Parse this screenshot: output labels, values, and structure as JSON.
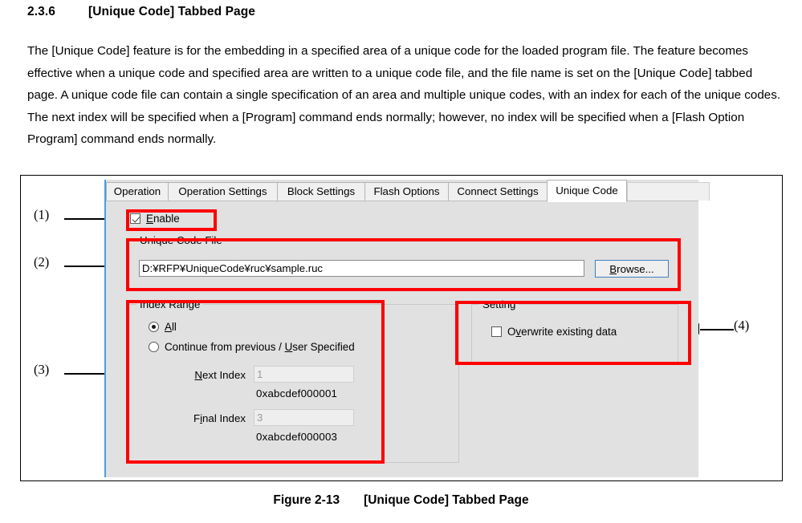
{
  "document": {
    "section_number": "2.3.6",
    "section_title": "[Unique Code] Tabbed Page",
    "paragraph": "The [Unique Code] feature is for the embedding in a specified area of a unique code for the loaded program file. The feature becomes effective when a unique code and specified area are written to a unique code file, and the file name is set on the [Unique Code] tabbed page. A unique code file can contain a single specification of an area and multiple unique codes, with an index for each of the unique codes. The next index will be specified when a [Program] command ends normally; however, no index will be specified when a [Flash Option Program] command ends normally.",
    "figure_caption_label": "Figure 2-13",
    "figure_caption_title": "[Unique Code] Tabbed Page"
  },
  "callouts": {
    "one": "(1)",
    "two": "(2)",
    "three": "(3)",
    "four": "(4)"
  },
  "dialog": {
    "tabs": [
      {
        "label": "Operation",
        "active": false
      },
      {
        "label": "Operation Settings",
        "active": false
      },
      {
        "label": "Block Settings",
        "active": false
      },
      {
        "label": "Flash Options",
        "active": false
      },
      {
        "label": "Connect Settings",
        "active": false
      },
      {
        "label": "Unique Code",
        "active": true
      }
    ],
    "enable_checkbox": {
      "label_pre": "",
      "accel": "E",
      "label_post": "nable",
      "checked": true
    },
    "unique_code_file": {
      "group_title": "Unique Code File",
      "path_value": "D:¥RFP¥UniqueCode¥ruc¥sample.ruc",
      "browse_accel": "B",
      "browse_post": "rowse..."
    },
    "index_range": {
      "group_title": "Index Range",
      "radio_all": {
        "accel": "A",
        "label_post": "ll",
        "selected": true
      },
      "radio_continue": {
        "label_pre": "Continue from previous / ",
        "accel": "U",
        "label_post": "ser Specified",
        "selected": false
      },
      "next_index": {
        "label_pre": "",
        "accel": "N",
        "label_post": "ext Index",
        "value": "1",
        "hex": "0xabcdef000001",
        "disabled": true
      },
      "final_index": {
        "label_pre": "F",
        "accel": "i",
        "label_post": "nal Index",
        "value": "3",
        "hex": "0xabcdef000003",
        "disabled": true
      }
    },
    "setting": {
      "group_title": "Setting",
      "overwrite_checkbox": {
        "label_pre": "O",
        "accel": "v",
        "label_post": "erwrite existing data",
        "checked": false
      }
    }
  },
  "colors": {
    "annotation_red": "#ff0000",
    "dialog_bg": "#e1e1e1",
    "focus_blue": "#3f7fbf"
  }
}
